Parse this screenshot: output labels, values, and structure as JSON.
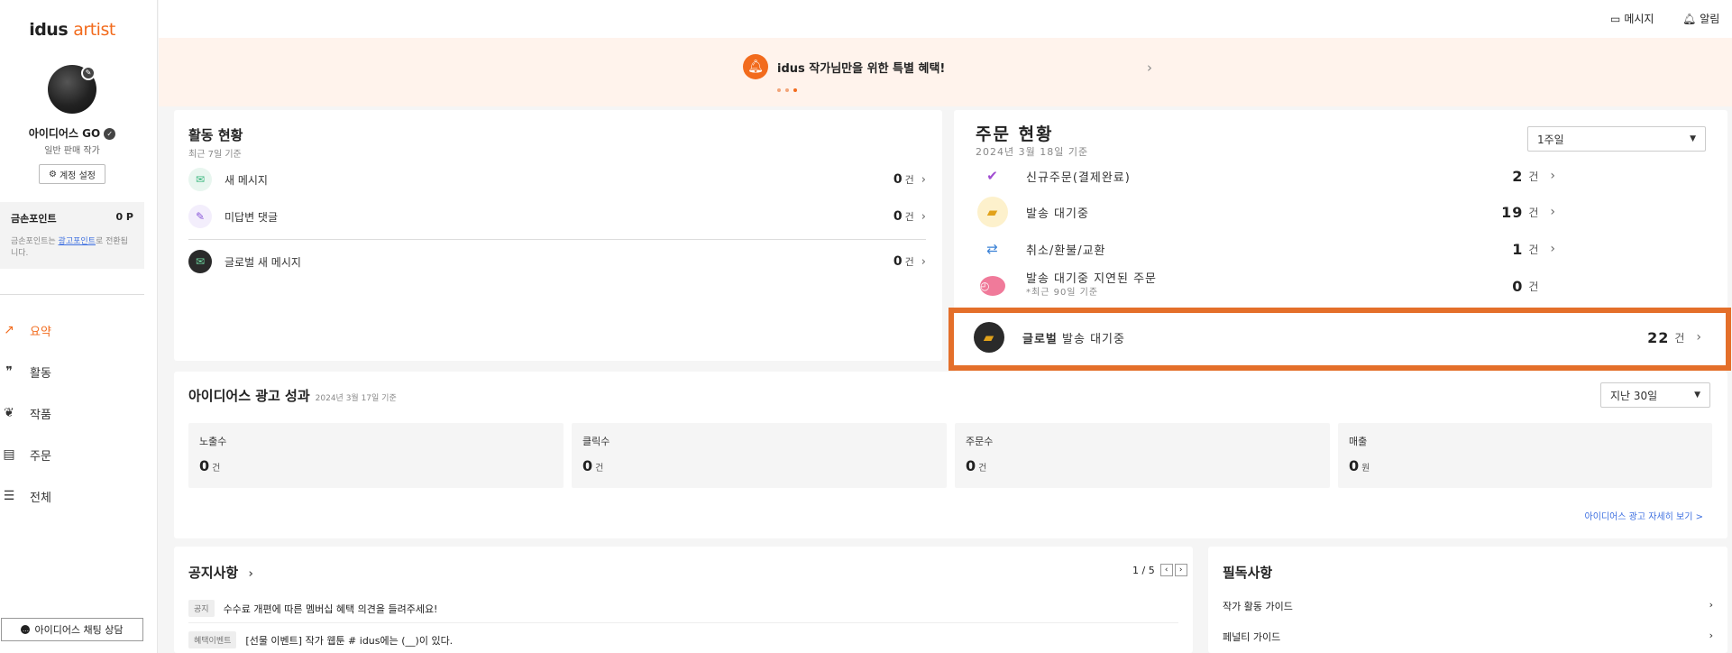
{
  "sidebar": {
    "logo_a": "idus",
    "logo_b": "artist",
    "profile_name": "아이디어스 GO",
    "profile_role": "일반 판매 작가",
    "settings_label": "계정 설정",
    "points_label": "금손포인트",
    "points_value": "0 P",
    "points_desc_prefix": "금손포인트는 ",
    "points_desc_link": "광고포인트",
    "points_desc_suffix": "로 전환됩니다.",
    "nav": [
      {
        "label": "요약"
      },
      {
        "label": "활동"
      },
      {
        "label": "작품"
      },
      {
        "label": "주문"
      },
      {
        "label": "전체"
      }
    ],
    "chat_label": "아이디어스 채팅 상담"
  },
  "header": {
    "messages_label": "메시지",
    "alerts_label": "알림"
  },
  "banner": {
    "text": "idus 작가님만을 위한 특별 혜택!"
  },
  "activity": {
    "title": "활동 현황",
    "subtitle": "최근 7일 기준",
    "rows": [
      {
        "label": "새 메시지",
        "count": "0",
        "unit": "건"
      },
      {
        "label": "미답변 댓글",
        "count": "0",
        "unit": "건"
      },
      {
        "label": "글로벌 새 메시지",
        "count": "0",
        "unit": "건"
      }
    ]
  },
  "orders": {
    "title": "주문 현황",
    "subtitle": "2024년 3월 18일 기준",
    "period": "1주일",
    "rows": [
      {
        "label": "신규주문(결제완료)",
        "count": "2",
        "unit": "건"
      },
      {
        "label": "발송 대기중",
        "count": "19",
        "unit": "건"
      },
      {
        "label": "취소/환불/교환",
        "count": "1",
        "unit": "건"
      },
      {
        "label": "발송 대기중 지연된 주문",
        "note": "*최근 90일 기준",
        "count": "0",
        "unit": "건"
      },
      {
        "label_bold": "글로벌",
        "label": "발송 대기중",
        "count": "22",
        "unit": "건"
      }
    ]
  },
  "ads": {
    "title": "아이디어스 광고 성과",
    "subtitle": "2024년 3월 17일 기준",
    "period": "지난 30일",
    "metrics": [
      {
        "label": "노출수",
        "value": "0",
        "unit": "건"
      },
      {
        "label": "클릭수",
        "value": "0",
        "unit": "건"
      },
      {
        "label": "주문수",
        "value": "0",
        "unit": "건"
      },
      {
        "label": "매출",
        "value": "0",
        "unit": "원"
      }
    ],
    "detail_link": "아이디어스 광고 자세히 보기 >"
  },
  "notices": {
    "title": "공지사항",
    "pager": "1 / 5",
    "items": [
      {
        "tag": "공지",
        "text": "수수료 개편에 따른 멤버십 혜택 의견을 들려주세요!"
      },
      {
        "tag": "혜택이벤트",
        "text": "[선물 이벤트] 작가 웹툰 # idus에는 (__)이 있다."
      }
    ]
  },
  "must_read": {
    "title": "필독사항",
    "items": [
      {
        "label": "작가 활동 가이드"
      },
      {
        "label": "페널티 가이드"
      }
    ]
  }
}
